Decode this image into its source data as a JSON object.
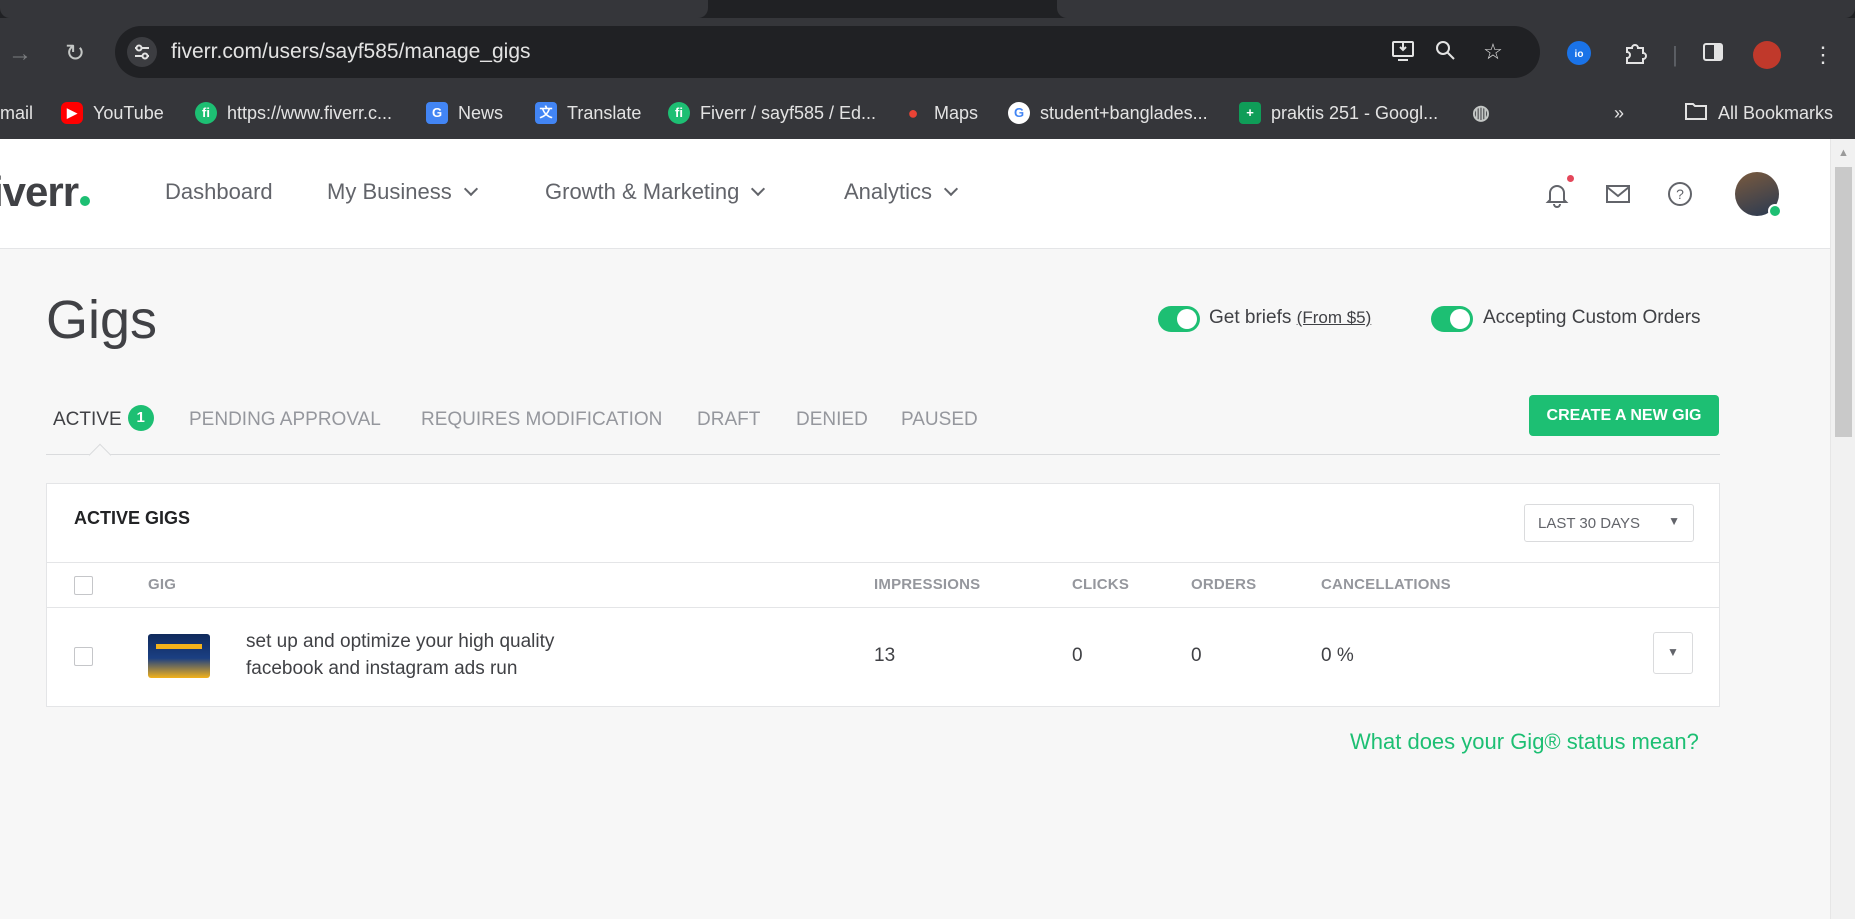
{
  "browser": {
    "url": "fiverr.com/users/sayf585/manage_gigs",
    "bookmarks": [
      {
        "label": "mail",
        "icon": "gmail-icon"
      },
      {
        "label": "YouTube",
        "icon": "youtube-icon"
      },
      {
        "label": "https://www.fiverr.c...",
        "icon": "fiverr-icon"
      },
      {
        "label": "News",
        "icon": "google-news-icon"
      },
      {
        "label": "Translate",
        "icon": "google-translate-icon"
      },
      {
        "label": "Fiverr / sayf585 / Ed...",
        "icon": "fiverr-icon"
      },
      {
        "label": "Maps",
        "icon": "google-maps-icon"
      },
      {
        "label": "student+banglades...",
        "icon": "google-icon"
      },
      {
        "label": "praktis 251 - Googl...",
        "icon": "google-sheets-icon"
      }
    ],
    "all_bookmarks": "All Bookmarks"
  },
  "header": {
    "logo": "iverr",
    "nav": [
      "Dashboard",
      "My Business",
      "Growth & Marketing",
      "Analytics"
    ]
  },
  "page": {
    "title": "Gigs",
    "get_briefs": "Get briefs",
    "get_briefs_link": "(From $5)",
    "custom_orders": "Accepting Custom Orders",
    "tabs": [
      {
        "label": "ACTIVE",
        "count": "1"
      },
      {
        "label": "PENDING APPROVAL"
      },
      {
        "label": "REQUIRES MODIFICATION"
      },
      {
        "label": "DRAFT"
      },
      {
        "label": "DENIED"
      },
      {
        "label": "PAUSED"
      }
    ],
    "create_button": "CREATE A NEW GIG",
    "panel_title": "ACTIVE GIGS",
    "range": "LAST 30 DAYS",
    "columns": [
      "GIG",
      "IMPRESSIONS",
      "CLICKS",
      "ORDERS",
      "CANCELLATIONS"
    ],
    "rows": [
      {
        "title": "set up and optimize your high quality facebook and instagram ads run",
        "impressions": "13",
        "clicks": "0",
        "orders": "0",
        "cancellations": "0 %"
      }
    ],
    "status_link": "What does your Gig® status mean?"
  },
  "colors": {
    "brand_green": "#1dbf73",
    "chrome_dark": "#202124",
    "chrome_toolbar": "#35363a"
  }
}
